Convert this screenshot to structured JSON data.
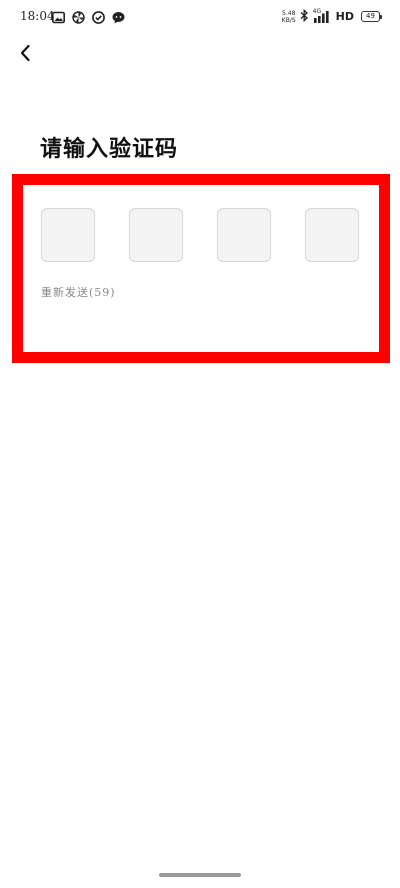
{
  "status_bar": {
    "time": "18:04",
    "notifications": [
      "image-icon",
      "pinwheel-icon",
      "check-circle-icon",
      "chat-bubble-icon"
    ],
    "net_speed_value": "5.48",
    "net_speed_unit": "KB/S",
    "signal_label": "4G",
    "hd_label": "HD",
    "battery_level": "49"
  },
  "header": {
    "back_icon": "chevron-left-icon"
  },
  "main": {
    "title": "请输入验证码",
    "code_boxes": [
      "",
      "",
      "",
      ""
    ],
    "resend_label": "重新发送(59)"
  },
  "colors": {
    "highlight": "#ff0000",
    "box_background": "#f4f4f4",
    "box_border": "#d6d6d6",
    "resend_text": "#888888"
  }
}
